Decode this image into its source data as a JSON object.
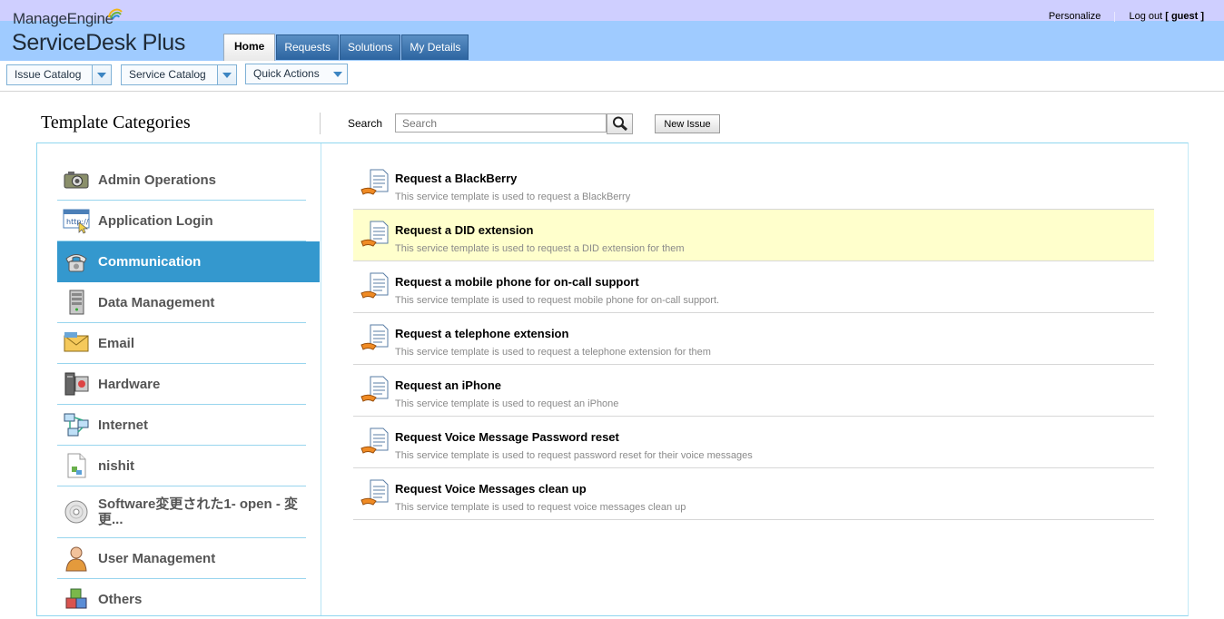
{
  "brand": {
    "vendor": "ManageEngine",
    "product": "ServiceDesk Plus"
  },
  "top_links": {
    "personalize": "Personalize",
    "logout": "Log out",
    "user": "[ guest ]"
  },
  "tabs": [
    {
      "label": "Home",
      "active": true
    },
    {
      "label": "Requests",
      "active": false
    },
    {
      "label": "Solutions",
      "active": false
    },
    {
      "label": "My Details",
      "active": false
    }
  ],
  "toolbar": {
    "issue_catalog": "Issue Catalog",
    "service_catalog": "Service Catalog",
    "quick_actions": "Quick Actions"
  },
  "page": {
    "title": "Template Categories",
    "search_label": "Search",
    "search_placeholder": "Search",
    "new_issue": "New Issue"
  },
  "categories": [
    {
      "name": "Admin Operations",
      "icon": "camera-icon"
    },
    {
      "name": "Application Login",
      "icon": "browser-login-icon"
    },
    {
      "name": "Communication",
      "icon": "telephone-icon",
      "active": true
    },
    {
      "name": "Data Management",
      "icon": "server-icon"
    },
    {
      "name": "Email",
      "icon": "envelope-icon"
    },
    {
      "name": "Hardware",
      "icon": "hardware-icon"
    },
    {
      "name": "Internet",
      "icon": "network-icon"
    },
    {
      "name": "nishit",
      "icon": "document-icon"
    },
    {
      "name": "Software変更された1- open - 変更...",
      "icon": "disc-icon"
    },
    {
      "name": "User Management",
      "icon": "user-icon"
    },
    {
      "name": "Others",
      "icon": "boxes-icon"
    }
  ],
  "templates": [
    {
      "name": "Request a BlackBerry",
      "desc": "This service template is used to request a BlackBerry"
    },
    {
      "name": "Request a DID extension",
      "desc": "This service template is used to request a DID extension for them",
      "highlight": true
    },
    {
      "name": "Request a mobile phone for on-call support",
      "desc": "This service template is used to request mobile phone for on-call support."
    },
    {
      "name": "Request a telephone extension",
      "desc": "This service template is used to request a telephone extension for them"
    },
    {
      "name": "Request an iPhone",
      "desc": "This service template is used to request an iPhone"
    },
    {
      "name": "Request Voice Message Password reset",
      "desc": "This service template is used to request password reset for their voice messages"
    },
    {
      "name": "Request Voice Messages clean up",
      "desc": "This service template is used to request voice messages clean up"
    }
  ],
  "colors": {
    "top_strip": "#cfcfff",
    "header": "#9fcbff",
    "active_category": "#3498ce",
    "highlight_row": "#ffffcc"
  }
}
